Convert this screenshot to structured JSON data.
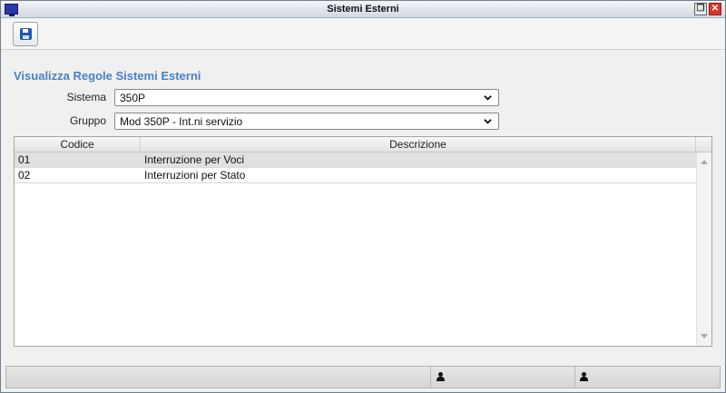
{
  "window": {
    "title": "Sistemi Esterni",
    "restore_glyph": "❐",
    "close_glyph": "✕"
  },
  "toolbar": {
    "save_icon": "floppy-disk-icon"
  },
  "form": {
    "heading": "Visualizza Regole Sistemi Esterni",
    "sistema": {
      "label": "Sistema",
      "value": "350P"
    },
    "gruppo": {
      "label": "Gruppo",
      "value": "Mod 350P - Int.ni servizio"
    }
  },
  "grid": {
    "columns": [
      "Codice",
      "Descrizione"
    ],
    "rows": [
      {
        "codice": "01",
        "descrizione": "Interruzione per Voci",
        "selected": true
      },
      {
        "codice": "02",
        "descrizione": "Interruzioni per Stato",
        "selected": false
      }
    ]
  },
  "statusbar": {
    "icons": [
      "user-icon",
      "user-icon"
    ]
  },
  "colors": {
    "heading": "#4a80c8",
    "close_button": "#d9362b",
    "selected_row": "#e0e0e0"
  }
}
